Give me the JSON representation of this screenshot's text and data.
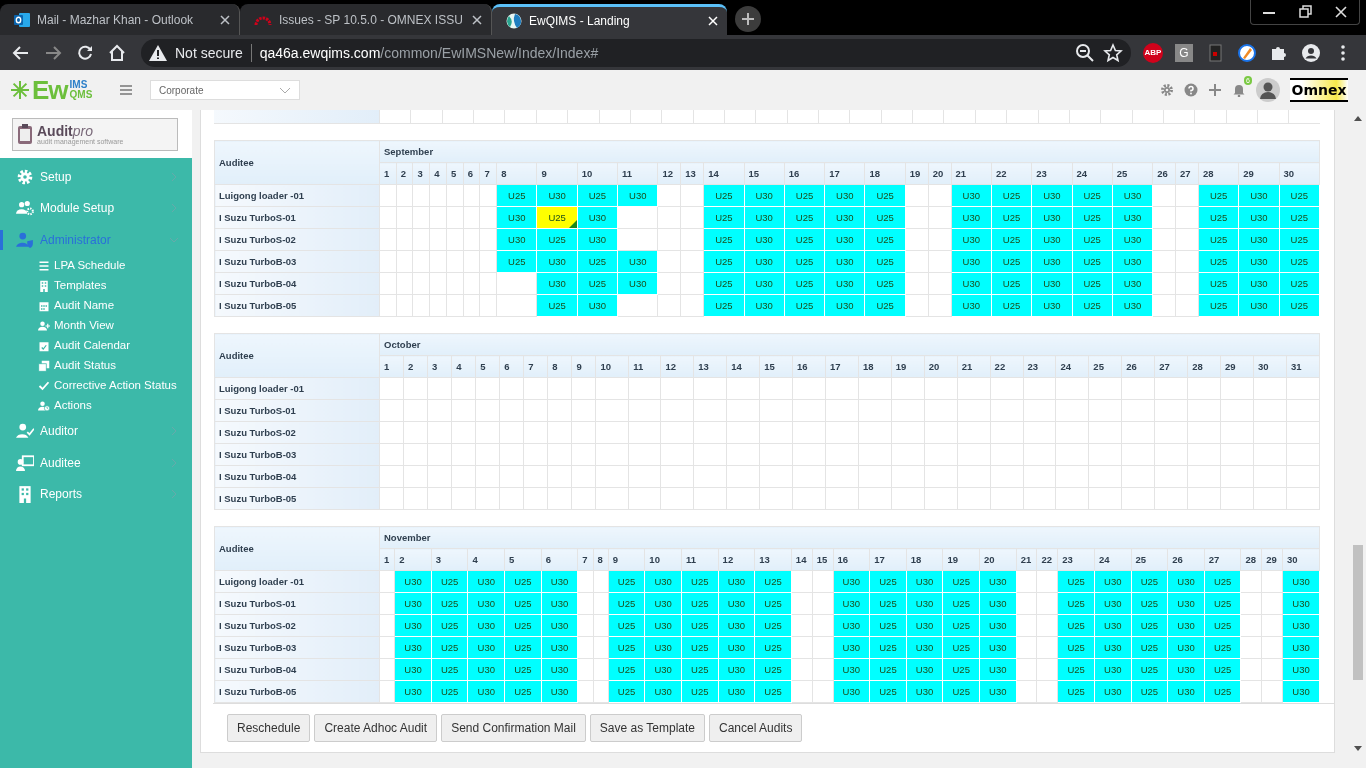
{
  "browser": {
    "tabs": [
      {
        "title": "Mail - Mazhar Khan - Outlook",
        "selected": false
      },
      {
        "title": "Issues - SP 10.5.0 - OMNEX ISSU",
        "selected": false
      },
      {
        "title": "EwQIMS - Landing",
        "selected": true
      }
    ],
    "address": {
      "security": "Not secure",
      "host": "qa46a.ewqims.com",
      "path": "/common/EwIMSNew/Index/Index#"
    },
    "extension_labels": [
      "ABP",
      "G"
    ]
  },
  "header": {
    "logo": {
      "main": "Ew",
      "top": "IMS",
      "bottom": "QMS"
    },
    "site_select": {
      "value": "Corporate"
    },
    "notification_count": "6",
    "brand": "Omnex"
  },
  "sidebar": {
    "logo": {
      "title": "Audit",
      "accent": "pro",
      "tagline": "audit management software"
    },
    "items": [
      {
        "label": "Setup",
        "expanded": false,
        "selected": false
      },
      {
        "label": "Module Setup",
        "expanded": false,
        "selected": false
      },
      {
        "label": "Administrator",
        "expanded": true,
        "selected": true,
        "children": [
          {
            "label": "LPA Schedule",
            "selected": false
          },
          {
            "label": "Templates",
            "selected": false
          },
          {
            "label": "Audit Name",
            "selected": false
          },
          {
            "label": "Month View",
            "selected": false
          },
          {
            "label": "Audit Calendar",
            "selected": false
          },
          {
            "label": "Audit Status",
            "selected": false
          },
          {
            "label": "Corrective Action Status",
            "selected": false
          },
          {
            "label": "Actions",
            "selected": false
          }
        ]
      },
      {
        "label": "Auditor",
        "expanded": false,
        "selected": false
      },
      {
        "label": "Auditee",
        "expanded": false,
        "selected": false
      },
      {
        "label": "Reports",
        "expanded": false,
        "selected": false
      }
    ]
  },
  "calendars": [
    {
      "column_header": "Auditee",
      "month": "September",
      "days": [
        "1",
        "2",
        "3",
        "4",
        "5",
        "6",
        "7",
        "8",
        "9",
        "10",
        "11",
        "12",
        "13",
        "14",
        "15",
        "16",
        "17",
        "18",
        "19",
        "20",
        "21",
        "22",
        "23",
        "24",
        "25",
        "26",
        "27",
        "28",
        "29",
        "30"
      ],
      "rows": [
        {
          "auditee": "Luigong loader -01",
          "cells": [
            null,
            null,
            null,
            null,
            null,
            null,
            null,
            "U25",
            "U30",
            "U25",
            "U30",
            null,
            null,
            "U25",
            "U30",
            "U25",
            "U30",
            "U25",
            null,
            null,
            "U30",
            "U25",
            "U30",
            "U25",
            "U30",
            null,
            null,
            "U25",
            "U30",
            "U25"
          ]
        },
        {
          "auditee": "I Suzu TurboS-01",
          "cells": [
            null,
            null,
            null,
            null,
            null,
            null,
            null,
            "U30",
            {
              "text": "U25",
              "highlighted": true
            },
            "U30",
            null,
            null,
            null,
            "U25",
            "U30",
            "U25",
            "U30",
            "U25",
            null,
            null,
            "U30",
            "U25",
            "U30",
            "U25",
            "U30",
            null,
            null,
            "U25",
            "U30",
            "U25"
          ]
        },
        {
          "auditee": "I Suzu TurboS-02",
          "cells": [
            null,
            null,
            null,
            null,
            null,
            null,
            null,
            "U30",
            "U25",
            "U30",
            null,
            null,
            null,
            "U25",
            "U30",
            "U25",
            "U30",
            "U25",
            null,
            null,
            "U30",
            "U25",
            "U30",
            "U25",
            "U30",
            null,
            null,
            "U25",
            "U30",
            "U25"
          ]
        },
        {
          "auditee": "I Suzu TurboB-03",
          "cells": [
            null,
            null,
            null,
            null,
            null,
            null,
            null,
            "U25",
            "U30",
            "U25",
            "U30",
            null,
            null,
            "U25",
            "U30",
            "U25",
            "U30",
            "U25",
            null,
            null,
            "U30",
            "U25",
            "U30",
            "U25",
            "U30",
            null,
            null,
            "U25",
            "U30",
            "U25"
          ]
        },
        {
          "auditee": "I Suzu TurboB-04",
          "cells": [
            null,
            null,
            null,
            null,
            null,
            null,
            null,
            null,
            "U30",
            "U25",
            "U30",
            null,
            null,
            "U25",
            "U30",
            "U25",
            "U30",
            "U25",
            null,
            null,
            "U30",
            "U25",
            "U30",
            "U25",
            "U30",
            null,
            null,
            "U25",
            "U30",
            "U25"
          ]
        },
        {
          "auditee": "I Suzu TurboB-05",
          "cells": [
            null,
            null,
            null,
            null,
            null,
            null,
            null,
            null,
            "U25",
            "U30",
            null,
            null,
            null,
            "U25",
            "U30",
            "U25",
            "U30",
            "U25",
            null,
            null,
            "U30",
            "U25",
            "U30",
            "U25",
            "U30",
            null,
            null,
            "U25",
            "U30",
            "U25"
          ]
        }
      ]
    },
    {
      "column_header": "Auditee",
      "month": "October",
      "days": [
        "1",
        "2",
        "3",
        "4",
        "5",
        "6",
        "7",
        "8",
        "9",
        "10",
        "11",
        "12",
        "13",
        "14",
        "15",
        "16",
        "17",
        "18",
        "19",
        "20",
        "21",
        "22",
        "23",
        "24",
        "25",
        "26",
        "27",
        "28",
        "29",
        "30",
        "31"
      ],
      "rows": [
        {
          "auditee": "Luigong loader -01"
        },
        {
          "auditee": "I Suzu TurboS-01"
        },
        {
          "auditee": "I Suzu TurboS-02"
        },
        {
          "auditee": "I Suzu TurboB-03"
        },
        {
          "auditee": "I Suzu TurboB-04"
        },
        {
          "auditee": "I Suzu TurboB-05"
        }
      ]
    },
    {
      "column_header": "Auditee",
      "month": "November",
      "days": [
        "1",
        "2",
        "3",
        "4",
        "5",
        "6",
        "7",
        "8",
        "9",
        "10",
        "11",
        "12",
        "13",
        "14",
        "15",
        "16",
        "17",
        "18",
        "19",
        "20",
        "21",
        "22",
        "23",
        "24",
        "25",
        "26",
        "27",
        "28",
        "29",
        "30"
      ],
      "rows": [
        {
          "auditee": "Luigong loader -01",
          "cells": [
            null,
            "U30",
            "U25",
            "U30",
            "U25",
            "U30",
            null,
            null,
            "U25",
            "U30",
            "U25",
            "U30",
            "U25",
            null,
            null,
            "U30",
            "U25",
            "U30",
            "U25",
            "U30",
            null,
            null,
            "U25",
            "U30",
            "U25",
            "U30",
            "U25",
            null,
            null,
            "U30"
          ]
        },
        {
          "auditee": "I Suzu TurboS-01",
          "cells": [
            null,
            "U30",
            "U25",
            "U30",
            "U25",
            "U30",
            null,
            null,
            "U25",
            "U30",
            "U25",
            "U30",
            "U25",
            null,
            null,
            "U30",
            "U25",
            "U30",
            "U25",
            "U30",
            null,
            null,
            "U25",
            "U30",
            "U25",
            "U30",
            "U25",
            null,
            null,
            "U30"
          ]
        },
        {
          "auditee": "I Suzu TurboS-02",
          "cells": [
            null,
            "U30",
            "U25",
            "U30",
            "U25",
            "U30",
            null,
            null,
            "U25",
            "U30",
            "U25",
            "U30",
            "U25",
            null,
            null,
            "U30",
            "U25",
            "U30",
            "U25",
            "U30",
            null,
            null,
            "U25",
            "U30",
            "U25",
            "U30",
            "U25",
            null,
            null,
            "U30"
          ]
        },
        {
          "auditee": "I Suzu TurboB-03",
          "cells": [
            null,
            "U30",
            "U25",
            "U30",
            "U25",
            "U30",
            null,
            null,
            "U25",
            "U30",
            "U25",
            "U30",
            "U25",
            null,
            null,
            "U30",
            "U25",
            "U30",
            "U25",
            "U30",
            null,
            null,
            "U25",
            "U30",
            "U25",
            "U30",
            "U25",
            null,
            null,
            "U30"
          ]
        },
        {
          "auditee": "I Suzu TurboB-04",
          "cells": [
            null,
            "U30",
            "U25",
            "U30",
            "U25",
            "U30",
            null,
            null,
            "U25",
            "U30",
            "U25",
            "U30",
            "U25",
            null,
            null,
            "U30",
            "U25",
            "U30",
            "U25",
            "U30",
            null,
            null,
            "U25",
            "U30",
            "U25",
            "U30",
            "U25",
            null,
            null,
            "U30"
          ]
        },
        {
          "auditee": "I Suzu TurboB-05",
          "cells": [
            null,
            "U30",
            "U25",
            "U30",
            "U25",
            "U30",
            null,
            null,
            "U25",
            "U30",
            "U25",
            "U30",
            "U25",
            null,
            null,
            "U30",
            "U25",
            "U30",
            "U25",
            "U30",
            null,
            null,
            "U25",
            "U30",
            "U25",
            "U30",
            "U25",
            null,
            null,
            "U30"
          ]
        }
      ]
    }
  ],
  "actions": [
    "Reschedule",
    "Create Adhoc Audit",
    "Send Confirmation Mail",
    "Save as Template",
    "Cancel Audits"
  ]
}
